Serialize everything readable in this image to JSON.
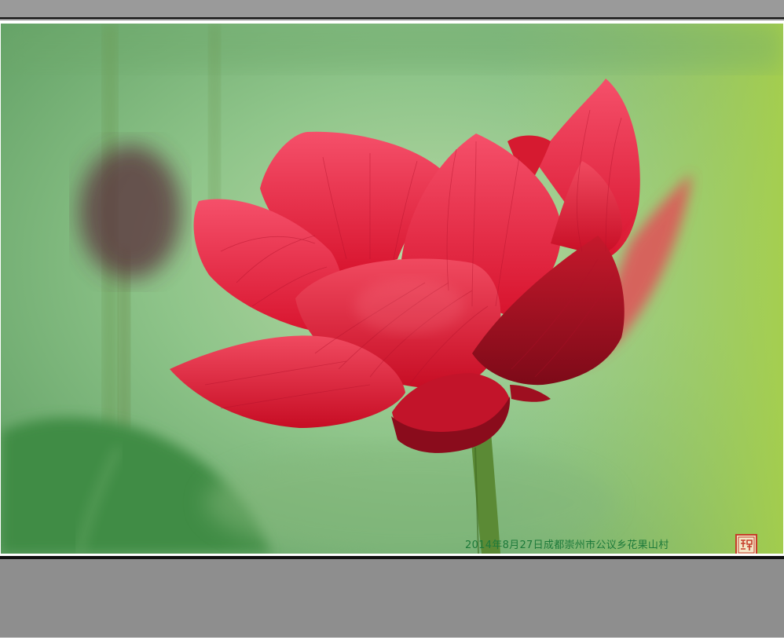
{
  "photo": {
    "subject": "lotus-flower",
    "caption": "2014年8月27日成都崇州市公议乡花果山村",
    "seal_icon": "red-seal-stamp-icon"
  },
  "colors": {
    "frame_gray": "#8e8e8e",
    "petal_red": "#e8243a",
    "background_green": "#8fc58a",
    "caption_green": "#1d7a3a"
  }
}
